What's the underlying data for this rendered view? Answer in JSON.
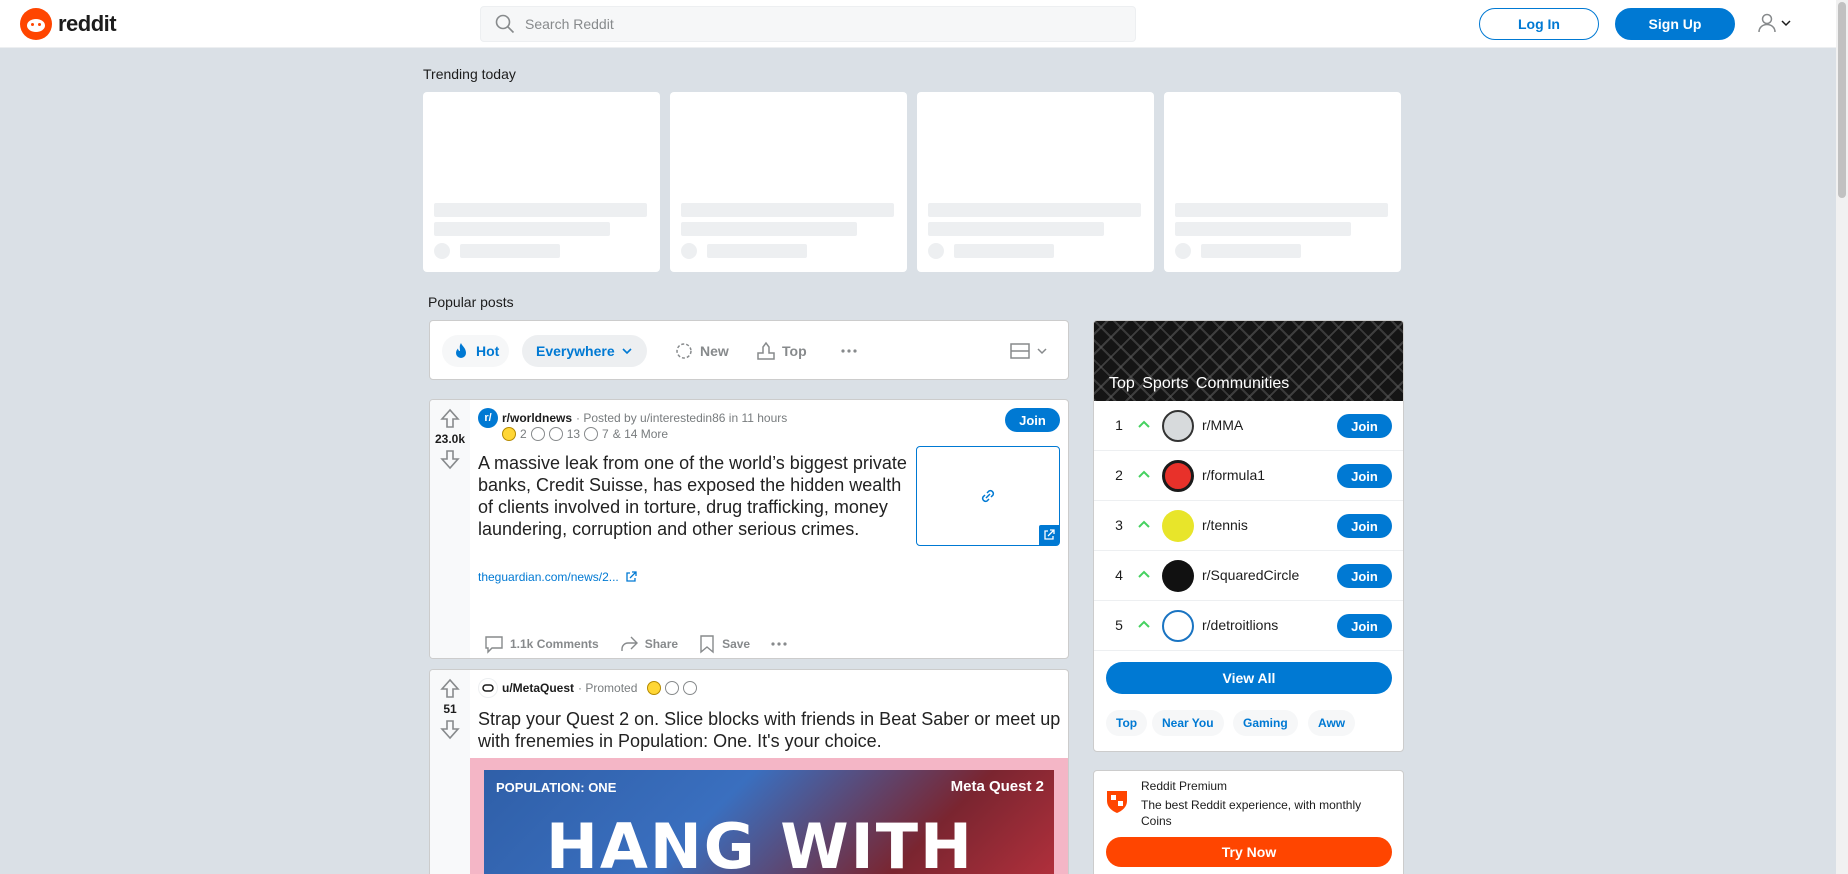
{
  "header": {
    "logo_text": "reddit",
    "search_placeholder": "Search Reddit",
    "login_label": "Log In",
    "signup_label": "Sign Up"
  },
  "trending": {
    "title": "Trending today"
  },
  "popular": {
    "title": "Popular posts"
  },
  "sortbar": {
    "hot": "Hot",
    "location": "Everywhere",
    "new": "New",
    "top": "Top"
  },
  "posts": [
    {
      "subreddit_icon_text": "r/",
      "subreddit": "r/worldnews",
      "posted_by": "· Posted by u/interestedin86 in 11 hours",
      "votes": "23.0k",
      "join_label": "Join",
      "awards": {
        "count_1": "2",
        "count_2": "13",
        "count_3": "7",
        "more": "& 14 More"
      },
      "title": "A massive leak from one of the world’s biggest private banks, Credit Suisse, has exposed the hidden wealth of clients involved in torture, drug trafficking, money laundering, corruption and other serious crimes.",
      "link": "theguardian.com/news/2...",
      "comments": "1.1k Comments",
      "share": "Share",
      "save": "Save"
    },
    {
      "author": "u/MetaQuest",
      "promoted": "· Promoted",
      "votes": "51",
      "title": "Strap your Quest 2 on. Slice blocks with friends in Beat Saber or meet up with frenemies in Population: One. It's your choice.",
      "ad_tag": "POPULATION: ONE",
      "ad_brand": "Meta Quest 2",
      "ad_headline": "HANG WITH"
    }
  ],
  "sidebar": {
    "title": "Top  Sports  Communities",
    "communities": [
      {
        "rank": "1",
        "name": "r/MMA",
        "join": "Join"
      },
      {
        "rank": "2",
        "name": "r/formula1",
        "join": "Join"
      },
      {
        "rank": "3",
        "name": "r/tennis",
        "join": "Join"
      },
      {
        "rank": "4",
        "name": "r/SquaredCircle",
        "join": "Join"
      },
      {
        "rank": "5",
        "name": "r/detroitlions",
        "join": "Join"
      }
    ],
    "view_all": "View All",
    "tags": [
      "Top",
      "Near You",
      "Gaming",
      "Aww"
    ]
  },
  "premium": {
    "title": "Reddit Premium",
    "description": "The best Reddit experience, with monthly Coins",
    "cta": "Try Now"
  },
  "colors": {
    "brand": "#ff4500",
    "accent": "#0079d3",
    "background": "#dae0e6"
  }
}
